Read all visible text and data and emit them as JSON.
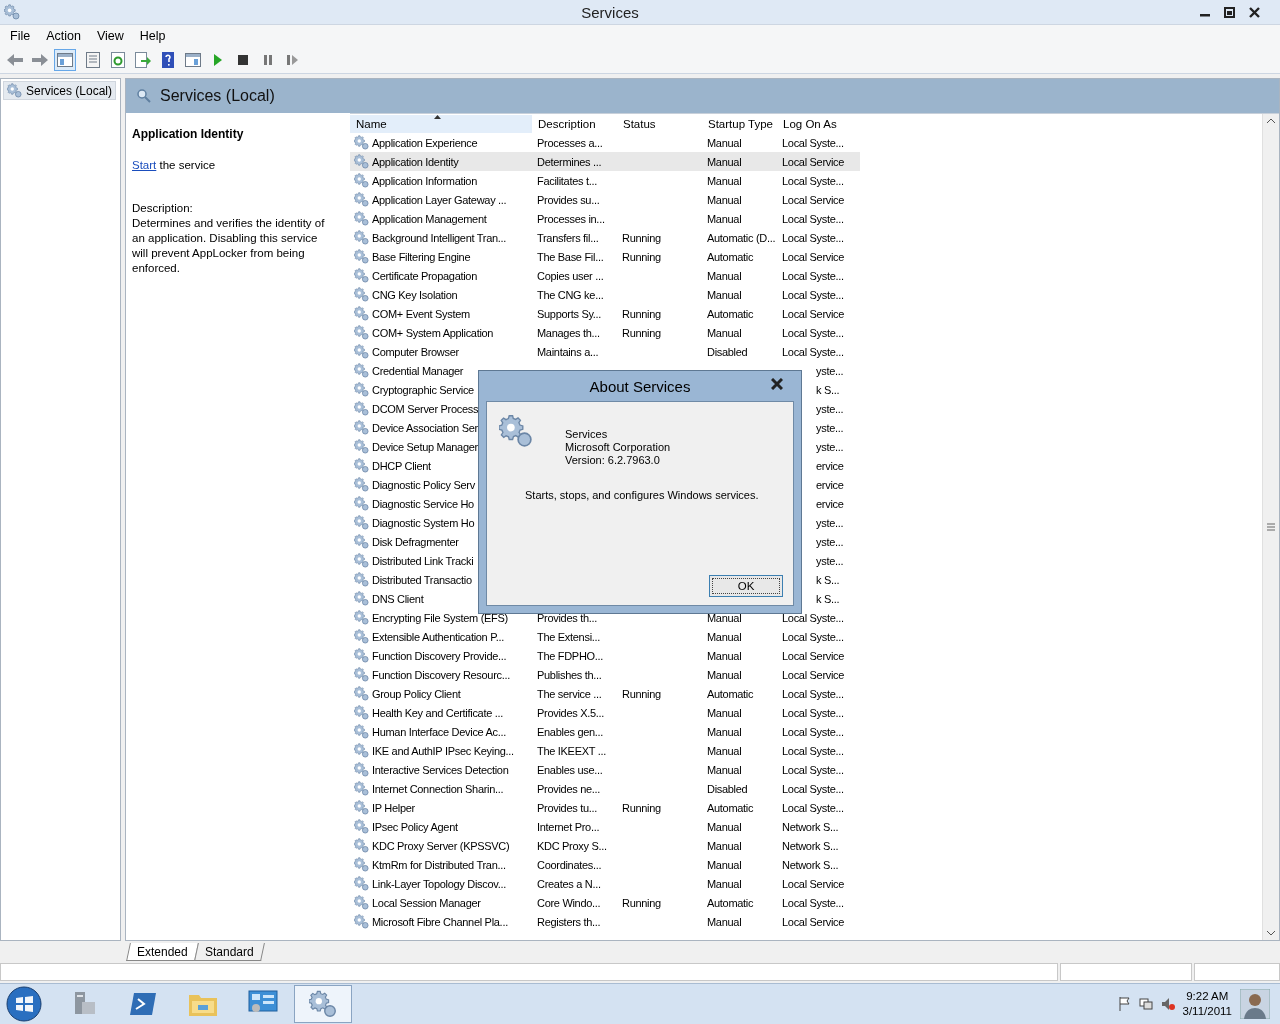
{
  "window": {
    "title": "Services"
  },
  "menu": [
    "File",
    "Action",
    "View",
    "Help"
  ],
  "toolbar": [
    {
      "kind": "back",
      "pressed": false
    },
    {
      "kind": "forward",
      "pressed": false
    },
    {
      "kind": "console-tree",
      "pressed": true
    },
    {
      "kind": "properties",
      "pressed": false
    },
    {
      "kind": "refresh",
      "pressed": false
    },
    {
      "kind": "export",
      "pressed": false
    },
    {
      "kind": "help",
      "pressed": false
    },
    {
      "kind": "action-pane",
      "pressed": false
    },
    {
      "kind": "play",
      "pressed": false
    },
    {
      "kind": "stop",
      "pressed": false
    },
    {
      "kind": "pause",
      "pressed": false
    },
    {
      "kind": "resume",
      "pressed": false
    }
  ],
  "tree": [
    {
      "label": "Services (Local)",
      "selected": true
    }
  ],
  "pane_header": "Services (Local)",
  "details": {
    "title": "Application Identity",
    "action_link": "Start",
    "action_text": " the service",
    "description_label": "Description:",
    "description": "Determines and verifies the identity of an application. Disabling this service will prevent AppLocker from being enforced."
  },
  "table": {
    "columns": [
      {
        "label": "Name",
        "sorted": true
      },
      {
        "label": "Description",
        "sorted": false
      },
      {
        "label": "Status",
        "sorted": false
      },
      {
        "label": "Startup Type",
        "sorted": false
      },
      {
        "label": "Log On As",
        "sorted": false
      }
    ],
    "rows": [
      {
        "kind": "full",
        "selected": false,
        "name": "Application Experience",
        "description": "Processes a...",
        "startup_type": "Manual",
        "log_on_as": "Local Syste..."
      },
      {
        "kind": "full",
        "selected": true,
        "name": "Application Identity",
        "description": "Determines ...",
        "startup_type": "Manual",
        "log_on_as": "Local Service"
      },
      {
        "kind": "full",
        "selected": false,
        "name": "Application Information",
        "description": "Facilitates t...",
        "startup_type": "Manual",
        "log_on_as": "Local Syste..."
      },
      {
        "kind": "full",
        "selected": false,
        "name": "Application Layer Gateway ...",
        "description": "Provides su...",
        "startup_type": "Manual",
        "log_on_as": "Local Service"
      },
      {
        "kind": "full",
        "selected": false,
        "name": "Application Management",
        "description": "Processes in...",
        "startup_type": "Manual",
        "log_on_as": "Local Syste..."
      },
      {
        "kind": "full",
        "selected": false,
        "name": "Background Intelligent Tran...",
        "description": "Transfers fil...",
        "status": "Running",
        "startup_type": "Automatic (D...",
        "log_on_as": "Local Syste..."
      },
      {
        "kind": "full",
        "selected": false,
        "name": "Base Filtering Engine",
        "description": "The Base Fil...",
        "status": "Running",
        "startup_type": "Automatic",
        "log_on_as": "Local Service"
      },
      {
        "kind": "full",
        "selected": false,
        "name": "Certificate Propagation",
        "description": "Copies user ...",
        "startup_type": "Manual",
        "log_on_as": "Local Syste..."
      },
      {
        "kind": "full",
        "selected": false,
        "name": "CNG Key Isolation",
        "description": "The CNG ke...",
        "startup_type": "Manual",
        "log_on_as": "Local Syste..."
      },
      {
        "kind": "full",
        "selected": false,
        "name": "COM+ Event System",
        "description": "Supports Sy...",
        "status": "Running",
        "startup_type": "Automatic",
        "log_on_as": "Local Service"
      },
      {
        "kind": "full",
        "selected": false,
        "name": "COM+ System Application",
        "description": "Manages th...",
        "status": "Running",
        "startup_type": "Manual",
        "log_on_as": "Local Syste..."
      },
      {
        "kind": "full",
        "selected": false,
        "name": "Computer Browser",
        "description": "Maintains a...",
        "startup_type": "Disabled",
        "log_on_as": "Local Syste..."
      },
      {
        "kind": "covered",
        "selected": false,
        "name": "Credential Manager",
        "log_on_as": "yste..."
      },
      {
        "kind": "covered",
        "selected": false,
        "name": "Cryptographic Service",
        "log_on_as": "k S..."
      },
      {
        "kind": "covered",
        "selected": false,
        "name": "DCOM Server Process",
        "log_on_as": "yste..."
      },
      {
        "kind": "covered",
        "selected": false,
        "name": "Device Association Ser",
        "log_on_as": "yste..."
      },
      {
        "kind": "covered",
        "selected": false,
        "name": "Device Setup Manager",
        "log_on_as": "yste..."
      },
      {
        "kind": "covered",
        "selected": false,
        "name": "DHCP Client",
        "log_on_as": "ervice"
      },
      {
        "kind": "covered",
        "selected": false,
        "name": "Diagnostic Policy Serv",
        "log_on_as": "ervice"
      },
      {
        "kind": "covered",
        "selected": false,
        "name": "Diagnostic Service Ho",
        "log_on_as": "ervice"
      },
      {
        "kind": "covered",
        "selected": false,
        "name": "Diagnostic System Ho",
        "log_on_as": "yste..."
      },
      {
        "kind": "covered",
        "selected": false,
        "name": "Disk Defragmenter",
        "log_on_as": "yste..."
      },
      {
        "kind": "covered",
        "selected": false,
        "name": "Distributed Link Tracki",
        "log_on_as": "yste..."
      },
      {
        "kind": "covered",
        "selected": false,
        "name": "Distributed Transactio",
        "log_on_as": "k S..."
      },
      {
        "kind": "covered",
        "selected": false,
        "name": "DNS Client",
        "log_on_as": "k S..."
      },
      {
        "kind": "full",
        "selected": false,
        "name": "Encrypting File System (EFS)",
        "description": "Provides th...",
        "startup_type": "Manual",
        "log_on_as": "Local Syste..."
      },
      {
        "kind": "full",
        "selected": false,
        "name": "Extensible Authentication P...",
        "description": "The Extensi...",
        "startup_type": "Manual",
        "log_on_as": "Local Syste..."
      },
      {
        "kind": "full",
        "selected": false,
        "name": "Function Discovery Provide...",
        "description": "The FDPHO...",
        "startup_type": "Manual",
        "log_on_as": "Local Service"
      },
      {
        "kind": "full",
        "selected": false,
        "name": "Function Discovery Resourc...",
        "description": "Publishes th...",
        "startup_type": "Manual",
        "log_on_as": "Local Service"
      },
      {
        "kind": "full",
        "selected": false,
        "name": "Group Policy Client",
        "description": "The service ...",
        "status": "Running",
        "startup_type": "Automatic",
        "log_on_as": "Local Syste..."
      },
      {
        "kind": "full",
        "selected": false,
        "name": "Health Key and Certificate ...",
        "description": "Provides X.5...",
        "startup_type": "Manual",
        "log_on_as": "Local Syste..."
      },
      {
        "kind": "full",
        "selected": false,
        "name": "Human Interface Device Ac...",
        "description": "Enables gen...",
        "startup_type": "Manual",
        "log_on_as": "Local Syste..."
      },
      {
        "kind": "full",
        "selected": false,
        "name": "IKE and AuthIP IPsec Keying...",
        "description": "The IKEEXT ...",
        "startup_type": "Manual",
        "log_on_as": "Local Syste..."
      },
      {
        "kind": "full",
        "selected": false,
        "name": "Interactive Services Detection",
        "description": "Enables use...",
        "startup_type": "Manual",
        "log_on_as": "Local Syste..."
      },
      {
        "kind": "full",
        "selected": false,
        "name": "Internet Connection Sharin...",
        "description": "Provides ne...",
        "startup_type": "Disabled",
        "log_on_as": "Local Syste..."
      },
      {
        "kind": "full",
        "selected": false,
        "name": "IP Helper",
        "description": "Provides tu...",
        "status": "Running",
        "startup_type": "Automatic",
        "log_on_as": "Local Syste..."
      },
      {
        "kind": "full",
        "selected": false,
        "name": "IPsec Policy Agent",
        "description": "Internet Pro...",
        "startup_type": "Manual",
        "log_on_as": "Network S..."
      },
      {
        "kind": "full",
        "selected": false,
        "name": "KDC Proxy Server (KPSSVC)",
        "description": "KDC Proxy S...",
        "startup_type": "Manual",
        "log_on_as": "Network S..."
      },
      {
        "kind": "full",
        "selected": false,
        "name": "KtmRm for Distributed Tran...",
        "description": "Coordinates...",
        "startup_type": "Manual",
        "log_on_as": "Network S..."
      },
      {
        "kind": "full",
        "selected": false,
        "name": "Link-Layer Topology Discov...",
        "description": "Creates a N...",
        "startup_type": "Manual",
        "log_on_as": "Local Service"
      },
      {
        "kind": "full",
        "selected": false,
        "name": "Local Session Manager",
        "description": "Core Windo...",
        "status": "Running",
        "startup_type": "Automatic",
        "log_on_as": "Local Syste..."
      },
      {
        "kind": "full",
        "selected": false,
        "name": "Microsoft Fibre Channel Pla...",
        "description": "Registers th...",
        "startup_type": "Manual",
        "log_on_as": "Local Service"
      }
    ]
  },
  "view_tabs": [
    {
      "label": "Extended",
      "selected": true
    },
    {
      "label": "Standard",
      "selected": false
    }
  ],
  "dialog": {
    "title": "About Services",
    "product": "Services",
    "company": "Microsoft Corporation",
    "version": "Version: 6.2.7963.0",
    "summary": "Starts, stops, and configures Windows services.",
    "button": "OK"
  },
  "taskbar": {
    "apps": [
      {
        "kind": "server",
        "active": false
      },
      {
        "kind": "shell",
        "active": false
      },
      {
        "kind": "folder",
        "active": false
      },
      {
        "kind": "panel",
        "active": false
      },
      {
        "kind": "gear",
        "active": true
      }
    ],
    "clock": {
      "time": "9:22 AM",
      "date": "3/11/2011"
    }
  }
}
